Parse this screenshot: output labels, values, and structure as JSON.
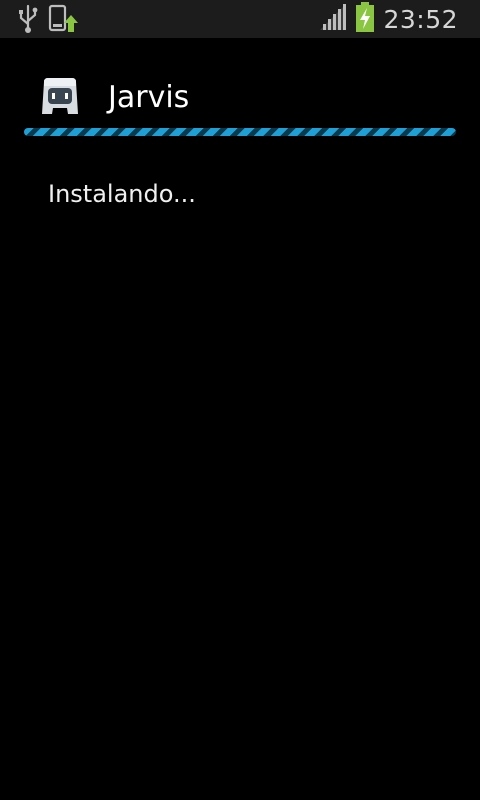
{
  "status_bar": {
    "time": "23:52",
    "icons": [
      "usb-icon",
      "app-update-icon",
      "signal-icon",
      "battery-charging-icon"
    ]
  },
  "dialog": {
    "title": "Jarvis",
    "message": "Instalando...",
    "progress_indeterminate": true,
    "accent_color": "#1ea0d6"
  }
}
